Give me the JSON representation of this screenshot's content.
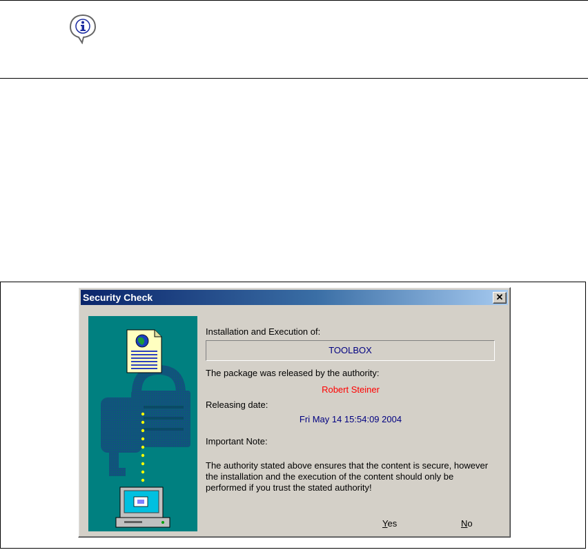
{
  "dialog": {
    "title": "Security Check",
    "close_glyph": "✕",
    "labels": {
      "install": "Installation and Execution of:",
      "released_by": "The package was released by the authority:",
      "release_date": "Releasing date:",
      "important_note": "Important Note:"
    },
    "package_name": "TOOLBOX",
    "authority": "Robert Steiner",
    "date": "Fri May 14 15:54:09 2004",
    "note": "The authority stated above ensures that the content is secure, however the installation and the execution of the content should only be performed if you trust the stated authority!",
    "buttons": {
      "yes_mnemonic": "Y",
      "yes_rest": "es",
      "no_mnemonic": "N",
      "no_rest": "o"
    }
  },
  "icons": {
    "info": "info-icon",
    "document": "globe-document-icon",
    "padlock": "padlock-icon",
    "computer": "computer-icon"
  },
  "colors": {
    "dialog_face": "#d4d0c8",
    "titlebar_start": "#0a246a",
    "titlebar_end": "#a6caf0",
    "art_background": "#008080",
    "authority_text": "#ff0000",
    "value_text": "#000080"
  }
}
